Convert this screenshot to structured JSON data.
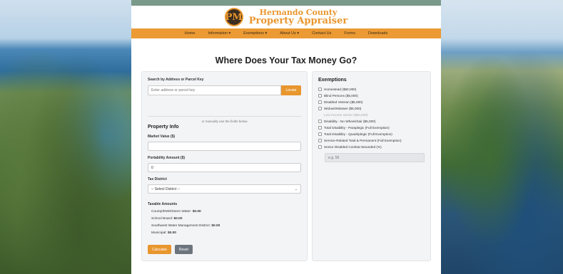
{
  "header": {
    "logo_text": "PM",
    "brand_line1": "Hernando County",
    "brand_line2": "Property Appraiser"
  },
  "nav": [
    {
      "label": "Home"
    },
    {
      "label": "Information ▾"
    },
    {
      "label": "Exemptions ▾"
    },
    {
      "label": "About Us ▾"
    },
    {
      "label": "Contact Us"
    },
    {
      "label": "Forms"
    },
    {
      "label": "Downloads"
    }
  ],
  "title": "Where Does Your Tax Money Go?",
  "search": {
    "label": "Search by Address or Parcel Key",
    "placeholder": "Enter address or parcel key",
    "locate_label": "Locate"
  },
  "divider_text": "or manually use the fields below",
  "property": {
    "title": "Property Info",
    "market_value_label": "Market Value ($)",
    "market_value": "",
    "portability_label": "Portability Amount ($)",
    "portability_value": "0",
    "tax_district_label": "Tax District",
    "tax_district_selected": "-- Select District --"
  },
  "taxable": {
    "title": "Taxable Amounts",
    "rows": [
      {
        "label": "County/EMS/Storm Water:",
        "value": "$0.00"
      },
      {
        "label": "School Board:",
        "value": "$0.00"
      },
      {
        "label": "Southwest Water Management District:",
        "value": "$0.00"
      },
      {
        "label": "Municipal:",
        "value": "$0.00"
      }
    ]
  },
  "buttons": {
    "calculate": "Calculate",
    "reset": "Reset"
  },
  "exemptions": {
    "title": "Exemptions",
    "items": [
      {
        "label": "Homestead ($50,000)",
        "disabled": false
      },
      {
        "label": "Blind Persons ($5,000)",
        "disabled": false
      },
      {
        "label": "Disabled Veteran ($5,000)",
        "disabled": false
      },
      {
        "label": "Widow/Widower ($5,000)",
        "disabled": false
      },
      {
        "label": "Low Income Senior ($50,000)",
        "disabled": true
      },
      {
        "label": "Disability - No Wheelchair ($5,000)",
        "disabled": false
      },
      {
        "label": "Total Disability - Paraplegic (Full Exemption)",
        "disabled": false
      },
      {
        "label": "Total Disability - Quadriplegic (Full Exemption)",
        "disabled": false
      },
      {
        "label": "Service-Related Total & Permanent (Full Exemption)",
        "disabled": false
      },
      {
        "label": "Senior Disabled Combat Wounded (%)",
        "disabled": false
      }
    ],
    "percent_placeholder": "e.g. 50"
  },
  "colors": {
    "accent": "#e8962e",
    "nav_bg": "#eb9a34",
    "reset": "#6c757d"
  }
}
